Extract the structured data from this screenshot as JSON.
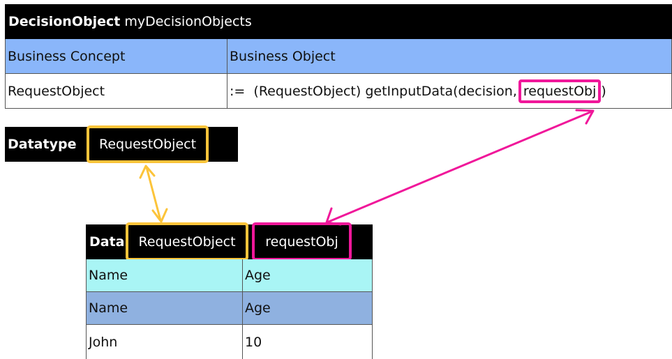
{
  "decision_table": {
    "title_bold": "DecisionObject",
    "title_rest": "myDecisionObjects",
    "col1_header": "Business Concept",
    "col2_header": "Business Object",
    "row_concept": "RequestObject",
    "row_expr_prefix": ":=  (RequestObject) getInputData(decision,",
    "row_expr_highlight": "requestObj",
    "row_expr_suffix": ")"
  },
  "datatype_box": {
    "label": "Datatype",
    "value": "RequestObject"
  },
  "data_table": {
    "label": "Data",
    "type_value": "RequestObject",
    "name_value": "requestObj",
    "rows": [
      [
        "Name",
        "Age"
      ],
      [
        "Name",
        "Age"
      ],
      [
        "John",
        "10"
      ]
    ]
  },
  "colors": {
    "header_black": "#000000",
    "header_blue": "#8ab6fa",
    "cyan_row": "#a9f5f5",
    "blue_row": "#8fb1e0",
    "highlight_yellow": "#fcc43a",
    "highlight_magenta": "#f0179a",
    "arrow_yellow": "#fcc43a",
    "arrow_magenta": "#f0179a"
  }
}
